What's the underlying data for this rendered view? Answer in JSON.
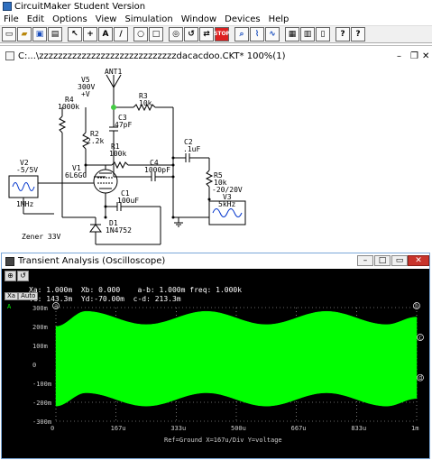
{
  "app": {
    "title": "CircuitMaker Student Version"
  },
  "menu": [
    "File",
    "Edit",
    "Options",
    "View",
    "Simulation",
    "Window",
    "Devices",
    "Help"
  ],
  "toolbar": {
    "icons": [
      "new-icon",
      "open-icon",
      "save-icon",
      "print-icon",
      "arrow-icon",
      "cross-icon",
      "text-icon",
      "probe-icon",
      "zoom-icon",
      "zoom-fit-icon",
      "digital-icon",
      "reset-icon",
      "step-icon",
      "stop-icon",
      "trace-icon",
      "analog-icon",
      "wave-icon",
      "grid-icon",
      "bus-icon",
      "help-icon",
      "context-help-icon"
    ],
    "stop_label": "STOP"
  },
  "schematic": {
    "window_title": "C:...\\zzzzzzzzzzzzzzzzzzzzzzzzzzzzzdacacdoo.CKT* 100%(1)",
    "components": {
      "antenna": "ANT1",
      "v5": [
        "V5",
        "300V",
        "+V"
      ],
      "r4": [
        "R4",
        "1000k"
      ],
      "r3": [
        "R3",
        "10k"
      ],
      "c3": [
        "C3",
        "47pF"
      ],
      "r2": [
        "R2",
        "2.2k"
      ],
      "r1": [
        "R1",
        "100k"
      ],
      "c2": [
        "C2",
        ".1uF"
      ],
      "v2": [
        "V2",
        "-5/5V"
      ],
      "v2_freq": "1MHz",
      "v1": [
        "V1",
        "6L6GC"
      ],
      "c4": [
        "C4",
        "1000pF"
      ],
      "r5": [
        "R5",
        "10k",
        "-20/20V"
      ],
      "v3": [
        "V3"
      ],
      "v3_freq": "5kHz",
      "c1": [
        "C1",
        "100uF"
      ],
      "d1": [
        "D1",
        "1N4752"
      ],
      "zener_label": "Zener 33V"
    }
  },
  "oscilloscope": {
    "window_title": "Transient Analysis (Oscilloscope)",
    "readout": {
      "xa": "Xa: 1.000m",
      "xb": "Xb: 0.000",
      "ab": "a-b: 1.000m",
      "freq": "freq: 1.000k",
      "yc": "Yc: 143.3m",
      "yd": "Yd:-70.00m",
      "cd": "c-d: 213.3m"
    },
    "axis_select": {
      "x": "Xa",
      "mode": "Auto"
    },
    "channel_label": "A",
    "footer": "Ref=Ground  X=167u/Div Y=voltage",
    "marker_labels": [
      "a",
      "b",
      "c",
      "d"
    ],
    "accent": "#00ff00",
    "grid_color": "#cccccc"
  },
  "chart_data": {
    "type": "area",
    "title": "",
    "xlabel": "",
    "ylabel": "",
    "x_ticks": [
      "0",
      "167u",
      "333u",
      "500u",
      "667u",
      "833u",
      "1m"
    ],
    "y_ticks": [
      "300m",
      "200m",
      "100m",
      "0",
      "-100m",
      "-200m",
      "-300m"
    ],
    "xlim": [
      0,
      1.0
    ],
    "ylim": [
      -0.3,
      0.3
    ],
    "x_unit": "ms",
    "series": [
      {
        "upper_envelope": {
          "x": [
            0,
            0.083,
            0.25,
            0.417,
            0.583,
            0.75,
            0.917,
            1.0
          ],
          "y": [
            0.2,
            0.28,
            0.21,
            0.28,
            0.21,
            0.28,
            0.21,
            0.25
          ]
        },
        "lower_envelope": {
          "x": [
            0,
            0.083,
            0.25,
            0.417,
            0.583,
            0.75,
            0.917,
            1.0
          ],
          "y": [
            -0.22,
            -0.15,
            -0.22,
            -0.15,
            -0.22,
            -0.15,
            -0.22,
            -0.18
          ]
        }
      }
    ]
  }
}
